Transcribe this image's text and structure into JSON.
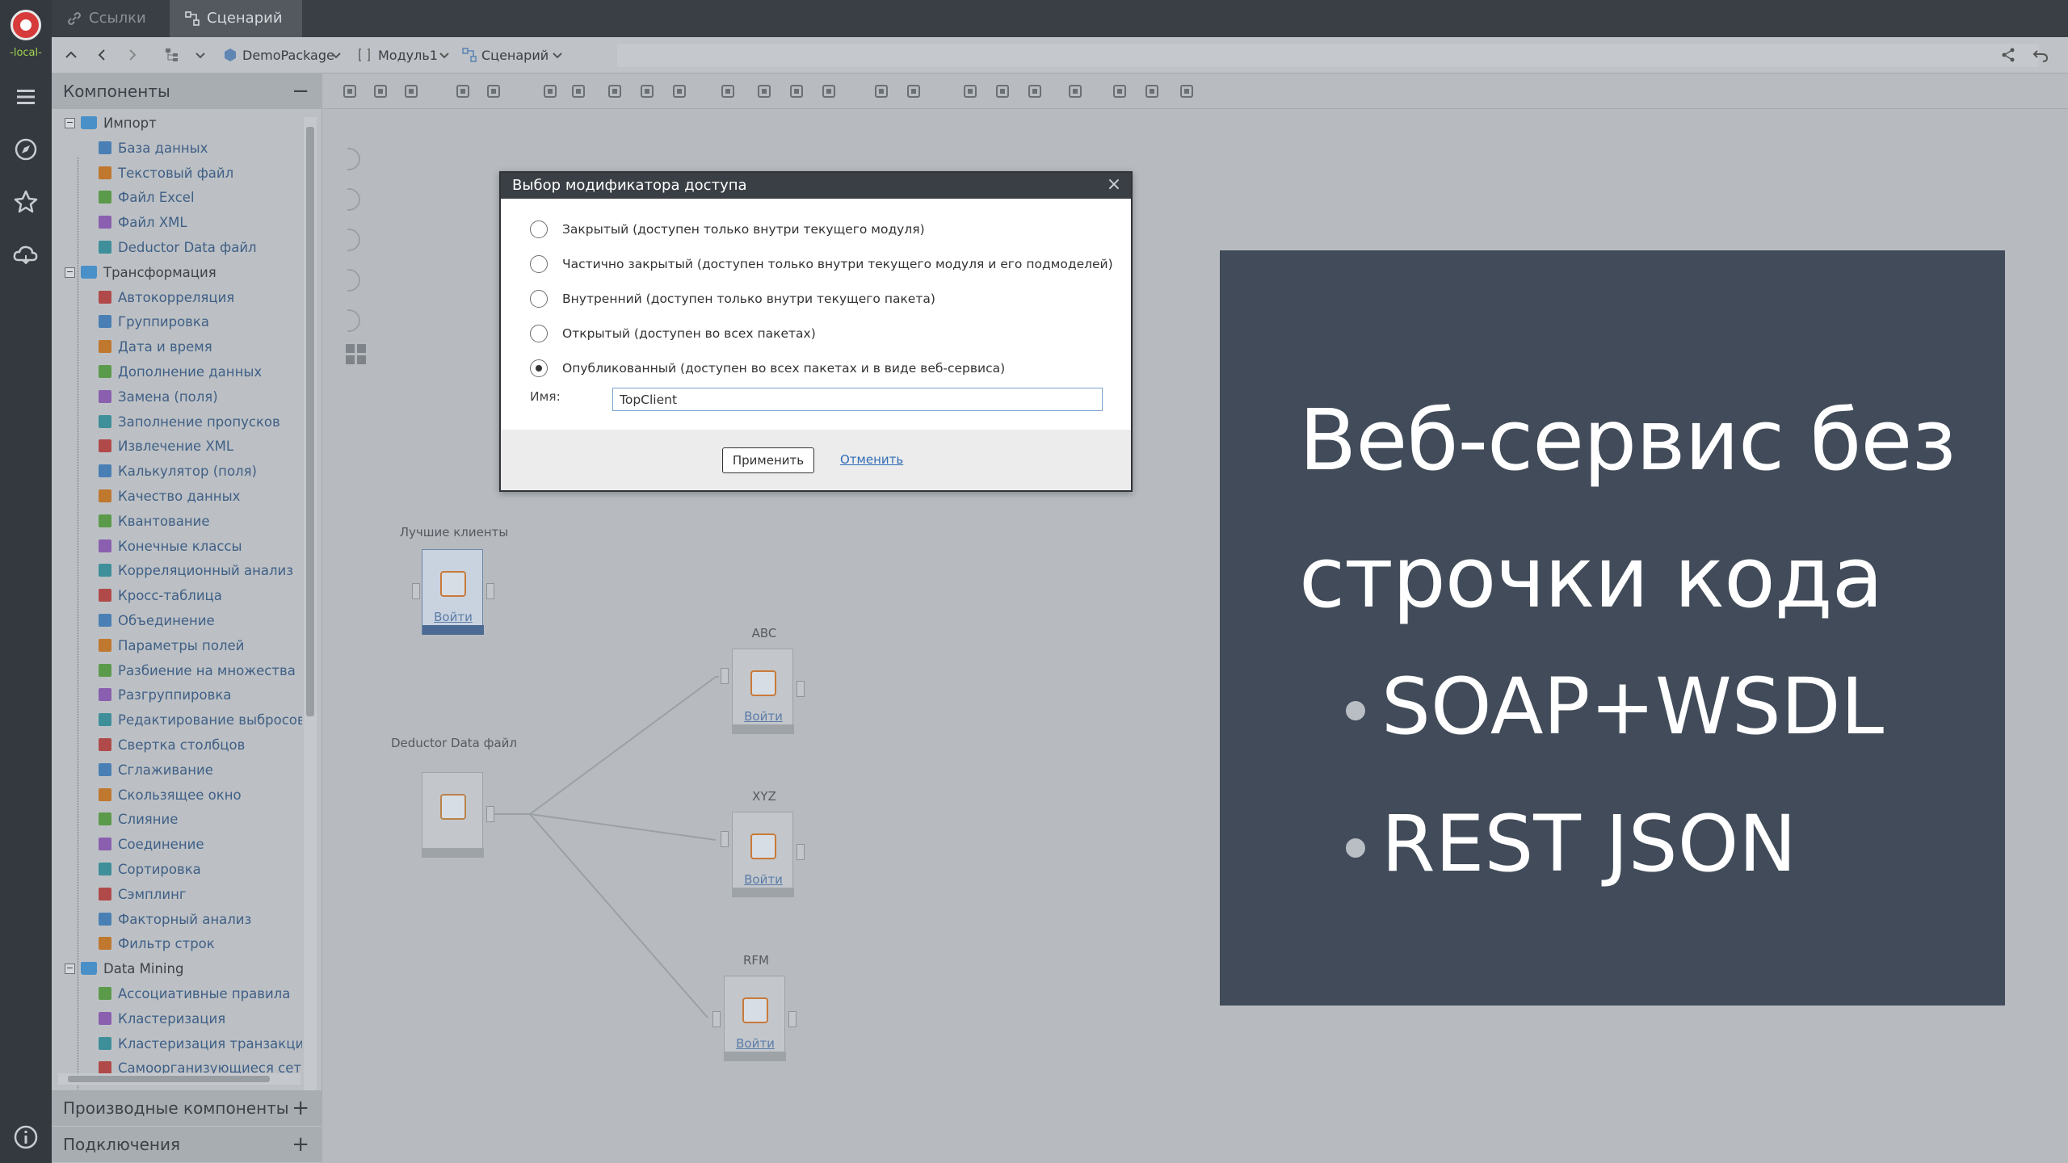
{
  "app": {
    "env_label": "-local-"
  },
  "tabs": [
    {
      "label": "Ссылки",
      "icon": "link-icon"
    },
    {
      "label": "Сценарий",
      "icon": "scenario-icon"
    }
  ],
  "breadcrumbs": [
    {
      "label": "DemoPackage",
      "icon": "package-icon"
    },
    {
      "label": "Модуль1",
      "icon": "module-icon"
    },
    {
      "label": "Сценарий",
      "icon": "scenario-icon"
    }
  ],
  "panels": {
    "components_title": "Компоненты",
    "derived_title": "Производные компоненты",
    "connections_title": "Подключения"
  },
  "tree": {
    "import": {
      "label": "Импорт",
      "items": [
        "База данных",
        "Текстовый файл",
        "Файл Excel",
        "Файл XML",
        "Deductor Data файл"
      ]
    },
    "transform": {
      "label": "Трансформация",
      "items": [
        "Автокорреляция",
        "Группировка",
        "Дата и время",
        "Дополнение данных",
        "Замена (поля)",
        "Заполнение пропусков",
        "Извлечение XML",
        "Калькулятор (поля)",
        "Качество данных",
        "Квантование",
        "Конечные классы",
        "Корреляционный анализ",
        "Кросс-таблица",
        "Объединение",
        "Параметры полей",
        "Разбиение на множества",
        "Разгруппировка",
        "Редактирование выбросов",
        "Свертка столбцов",
        "Сглаживание",
        "Скользящее окно",
        "Слияние",
        "Соединение",
        "Сортировка",
        "Сэмплинг",
        "Факторный анализ",
        "Фильтр строк"
      ]
    },
    "datamining": {
      "label": "Data Mining",
      "items": [
        "Ассоциативные правила",
        "Кластеризация",
        "Кластеризация транзакций",
        "Самоорганизующиеся сети"
      ]
    }
  },
  "nodes": {
    "best_clients": {
      "label": "Лучшие клиенты",
      "link": "Войти"
    },
    "deductor": {
      "label": "Deductor Data файл"
    },
    "abc": {
      "label": "ABC",
      "link": "Войти"
    },
    "xyz": {
      "label": "XYZ",
      "link": "Войти"
    },
    "rfm": {
      "label": "RFM",
      "link": "Войти"
    }
  },
  "dialog": {
    "title": "Выбор модификатора доступа",
    "options": [
      "Закрытый (доступен только внутри текущего модуля)",
      "Частично закрытый (доступен только внутри текущего модуля и его подмоделей)",
      "Внутренний (доступен только внутри текущего пакета)",
      "Открытый (доступен во всех пакетах)",
      "Опубликованный (доступен во всех пакетах и в виде веб-сервиса)"
    ],
    "selected_index": 4,
    "name_label": "Имя:",
    "name_value": "TopClient",
    "apply_label": "Применить",
    "cancel_label": "Отменить"
  },
  "slide": {
    "title": "Веб-сервис без строчки кода",
    "bullets": [
      "SOAP+WSDL",
      "REST JSON"
    ]
  }
}
